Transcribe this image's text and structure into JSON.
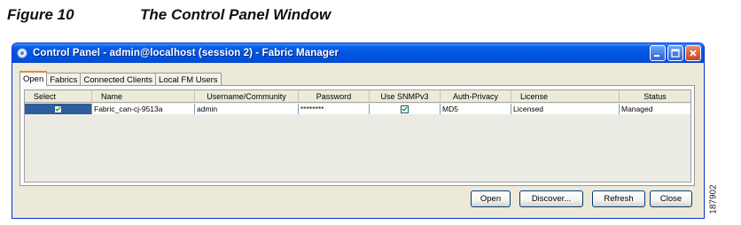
{
  "figure": {
    "number": "Figure 10",
    "title": "The Control Panel Window",
    "id": "187902"
  },
  "window": {
    "title": "Control Panel - admin@localhost (session 2) - Fabric Manager"
  },
  "tabs": [
    {
      "label": "Open",
      "active": true
    },
    {
      "label": "Fabrics",
      "active": false
    },
    {
      "label": "Connected Clients",
      "active": false
    },
    {
      "label": "Local FM Users",
      "active": false
    }
  ],
  "table": {
    "columns": [
      "Select",
      "Name",
      "Username/Community",
      "Password",
      "Use SNMPv3",
      "Auth-Privacy",
      "License",
      "Status"
    ],
    "rows": [
      {
        "select": true,
        "name": "Fabric_can-cj-9513a",
        "username": "admin",
        "password": "********",
        "use_snmpv3": true,
        "auth_privacy": "MD5",
        "license": "Licensed",
        "status": "Managed"
      }
    ]
  },
  "buttons": {
    "open": "Open",
    "discover": "Discover...",
    "refresh": "Refresh",
    "close": "Close"
  },
  "colors": {
    "titlebar": "#0054e3",
    "selected_row": "#2f5e9e",
    "active_tab_accent": "#e68b2c",
    "window_face": "#ece9d8"
  }
}
